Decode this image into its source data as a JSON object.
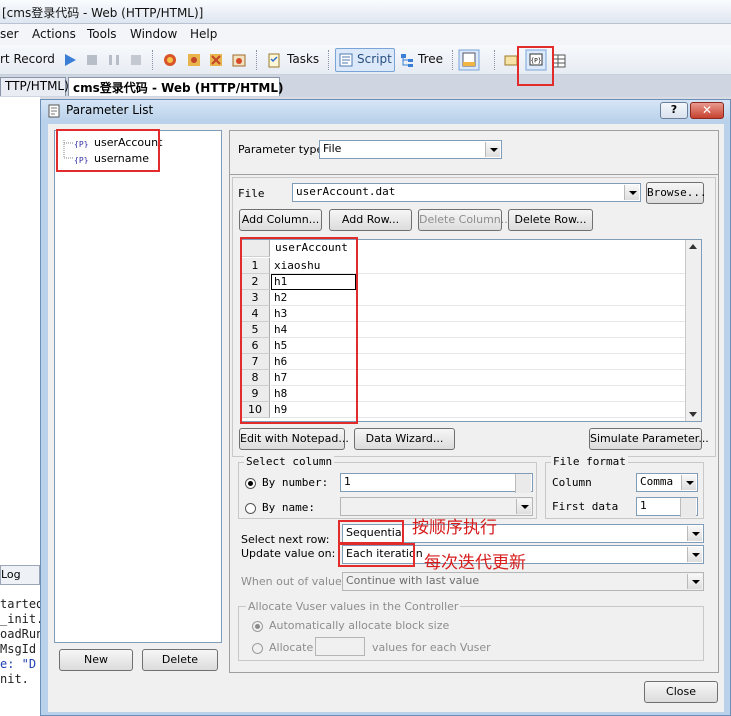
{
  "app": {
    "title": "[cms登录代码 - Web (HTTP/HTML)]",
    "menu": [
      "ser",
      "Actions",
      "Tools",
      "Window",
      "Help"
    ],
    "toolbar": {
      "record_label": "rt Record",
      "tasks_label": "Tasks",
      "script_label": "Script",
      "tree_label": "Tree"
    },
    "doc_tabs": [
      "TTP/HTML)",
      "cms登录代码 - Web (HTTP/HTML)"
    ],
    "log_tab": "Log",
    "code_lines": [
      "tarted",
      "_init.",
      "oadRun",
      "MsgId",
      "e: \"D",
      "nit."
    ]
  },
  "dialog": {
    "title": "Parameter List",
    "help_label": "?",
    "close_icon_label": "✕",
    "tree": {
      "items": [
        "userAccount",
        "username"
      ]
    },
    "new_button": "New",
    "delete_button": "Delete",
    "parameter_type_label": "Parameter type:",
    "parameter_type_value": "File",
    "file_label": "File",
    "file_value": "userAccount.dat",
    "browse_button": "Browse...",
    "add_column_button": "Add Column...",
    "add_row_button": "Add Row...",
    "delete_column_button": "Delete Column...",
    "delete_row_button": "Delete Row...",
    "grid": {
      "header": "userAccount",
      "rows": [
        {
          "num": "1",
          "value": "xiaoshu"
        },
        {
          "num": "2",
          "value": "h1"
        },
        {
          "num": "3",
          "value": "h2"
        },
        {
          "num": "4",
          "value": "h3"
        },
        {
          "num": "5",
          "value": "h4"
        },
        {
          "num": "6",
          "value": "h5"
        },
        {
          "num": "7",
          "value": "h6"
        },
        {
          "num": "8",
          "value": "h7"
        },
        {
          "num": "9",
          "value": "h8"
        },
        {
          "num": "10",
          "value": "h9"
        }
      ]
    },
    "edit_notepad_button": "Edit with Notepad...",
    "data_wizard_button": "Data Wizard...",
    "simulate_button": "Simulate Parameter...",
    "select_column": {
      "legend": "Select column",
      "by_number_label": "By number:",
      "by_number_value": "1",
      "by_name_label": "By name:"
    },
    "file_format": {
      "legend": "File format",
      "column_label": "Column",
      "column_value": "Comma",
      "first_data_label": "First data",
      "first_data_value": "1"
    },
    "select_next_row_label": "Select next row:",
    "select_next_row_value": "Sequential",
    "update_value_label": "Update value on:",
    "update_value_value": "Each iteration",
    "out_of_values_label": "When out of values:",
    "out_of_values_value": "Continue with last value",
    "allocate": {
      "legend": "Allocate Vuser values in the Controller",
      "auto_label": "Automatically allocate block size",
      "allocate_label": "Allocate",
      "values_label": "values for each Vuser"
    },
    "close_button": "Close"
  },
  "annotations": {
    "sequential_note": "按顺序执行",
    "iteration_note": "每次迭代更新"
  },
  "colors": {
    "highlight": "#e22b2b",
    "dialog_frame": "#b9d1ea"
  }
}
